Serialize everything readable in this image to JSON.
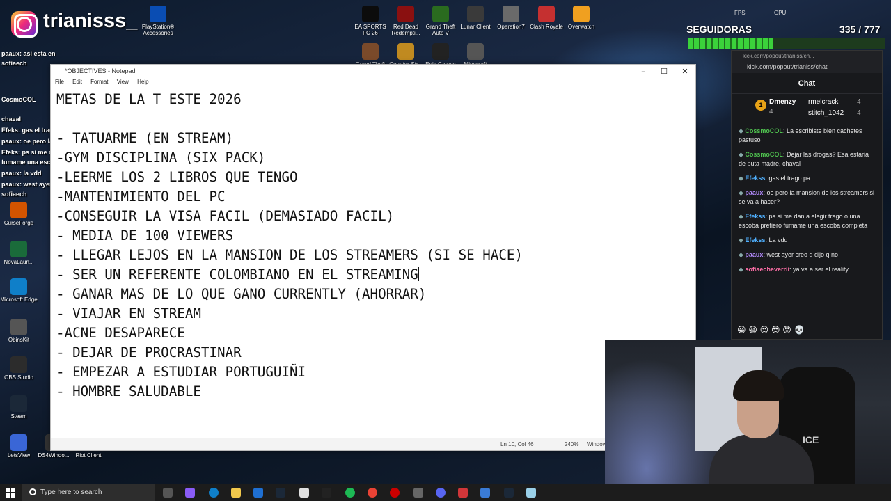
{
  "overlay": {
    "handle": "trianisss_",
    "followers_label": "SEGUIDORAS",
    "followers_count": "335 / 777",
    "followers_progress": 0.43,
    "fps": "FPS",
    "gpu": "GPU"
  },
  "desktop_icons": [
    {
      "label": "PlayStation® Accessories",
      "color": "#0a4db3"
    },
    {
      "label": "EA SPORTS FC 26",
      "color": "#0c0c0c"
    },
    {
      "label": "Red Dead Redempti...",
      "color": "#8a1010"
    },
    {
      "label": "Grand Theft Auto V",
      "color": "#2a6b1f"
    },
    {
      "label": "Lunar Client",
      "color": "#3a3a3a"
    },
    {
      "label": "Operation7",
      "color": "#6a6a6a"
    },
    {
      "label": "Clash Royale",
      "color": "#c53030"
    },
    {
      "label": "Overwatch",
      "color": "#f0a020"
    },
    {
      "label": "Grand Theft",
      "color": "#7a4a2a"
    },
    {
      "label": "Counter-Str...",
      "color": "#c08a20"
    },
    {
      "label": "Epic Games",
      "color": "#222"
    },
    {
      "label": "Minecraft",
      "color": "#555"
    },
    {
      "label": "CurseForge",
      "color": "#d35400"
    },
    {
      "label": "NovaLaun...",
      "color": "#1a6b3a"
    },
    {
      "label": "Microsoft Edge",
      "color": "#0f7fc9"
    },
    {
      "label": "ObinsKit",
      "color": "#555"
    },
    {
      "label": "OBS Studio",
      "color": "#2c2c2c"
    },
    {
      "label": "Steam",
      "color": "#1b2838"
    },
    {
      "label": "LetsView",
      "color": "#3a66d6"
    },
    {
      "label": "DS4Windo...",
      "color": "#333"
    },
    {
      "label": "Riot Client",
      "color": "#d13639"
    }
  ],
  "ghost_chat": [
    "paaux: asi esta en",
    "sofiaech",
    "CosmoCOL",
    "chaval",
    "Efeks: gas el trago",
    "paaux: oe pero la mansion",
    "Efeks: ps si me dan",
    "fumame una escoba",
    "paaux: la vdd",
    "paaux: west ayer",
    "sofiaech"
  ],
  "notepad": {
    "title": "*OBJECTIVES - Notepad",
    "menu": [
      "File",
      "Edit",
      "Format",
      "View",
      "Help"
    ],
    "lines": [
      "METAS DE LA T ESTE 2026",
      "",
      "- TATUARME (EN STREAM)",
      "-GYM DISCIPLINA (SIX PACK)",
      "-LEERME LOS 2 LIBROS QUE TENGO",
      "-MANTENIMIENTO DEL PC",
      "-CONSEGUIR LA VISA FACIL (DEMASIADO FACIL)",
      "- MEDIA DE 100 VIEWERS",
      "- LLEGAR LEJOS EN LA MANSION DE LOS STREAMERS (SI SE HACE)",
      "- SER UN REFERENTE COLOMBIANO EN EL STREAMING",
      "- GANAR MAS DE LO QUE GANO CURRENTLY (AHORRAR)",
      "- VIAJAR EN STREAM",
      "-ACNE DESAPARECE",
      "- DEJAR DE PROCRASTINAR",
      "- EMPEZAR A ESTUDIAR PORTUGUIÑI",
      "- HOMBRE SALUDABLE"
    ],
    "caret_line": 9,
    "status_position": "Ln 10, Col 46",
    "status_zoom": "240%",
    "status_eol": "Windows"
  },
  "chat": {
    "window_title": "kick.com/popout/trianiss/ch...",
    "url": "kick.com/popout/trianiss/chat",
    "header": "Chat",
    "top_gifter": {
      "rank": "1",
      "name": "Dmenzy",
      "count": "4"
    },
    "top_list": [
      {
        "name": "rmelcrack",
        "count": "4"
      },
      {
        "name": "stitch_1042",
        "count": "4"
      }
    ],
    "messages": [
      {
        "user": "CossmoCOL",
        "color": "#4fc14f",
        "text": "La escribiste bien cachetes pastuso"
      },
      {
        "user": "CossmoCOL",
        "color": "#4fc14f",
        "text": "Dejar las drogas? Esa estaria de puta madre, chaval"
      },
      {
        "user": "Efekss",
        "color": "#4fb0ff",
        "text": "gas el trago pa"
      },
      {
        "user": "paaux",
        "color": "#b58cff",
        "text": "oe pero la mansion de los streamers si se va a hacer?"
      },
      {
        "user": "Efekss",
        "color": "#4fb0ff",
        "text": "ps si me dan a elegir trago o una escoba prefiero fumame una escoba completa"
      },
      {
        "user": "Efekss",
        "color": "#4fb0ff",
        "text": "La vdd"
      },
      {
        "user": "paaux",
        "color": "#b58cff",
        "text": "west ayer creo q dijo q no"
      },
      {
        "user": "sofiaecheverrii",
        "color": "#ff6fa8",
        "text": "ya va a ser el reality"
      }
    ]
  },
  "taskbar": {
    "search_placeholder": "Type here to search"
  },
  "webcam": {
    "chair_logo": "ICE"
  }
}
